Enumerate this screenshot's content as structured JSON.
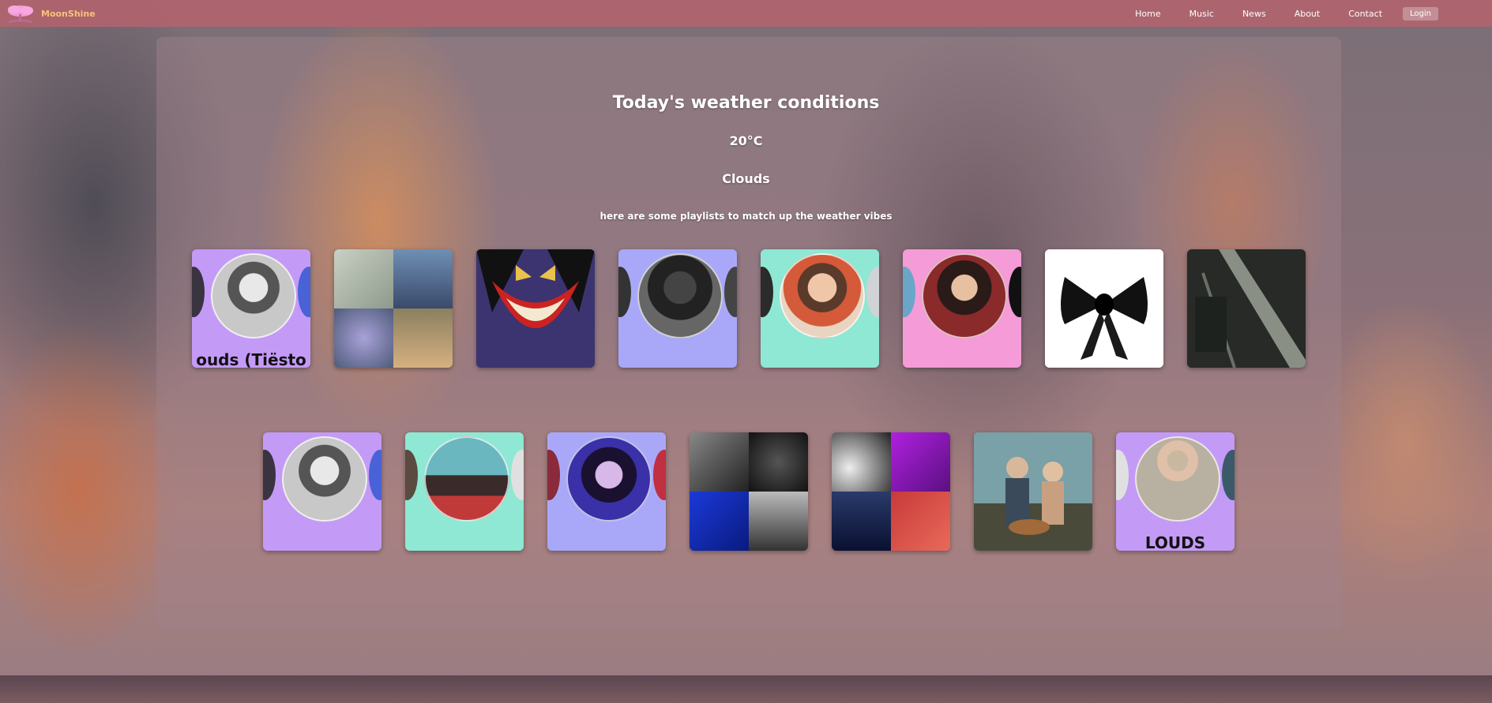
{
  "nav": {
    "brand": "MoonShine",
    "links": [
      "Home",
      "Music",
      "News",
      "About",
      "Contact"
    ],
    "login": "Login"
  },
  "weather": {
    "title": "Today's weather conditions",
    "temperature": "20°C",
    "condition": "Clouds",
    "subtitle": "here are some playlists to match up the weather vibes"
  },
  "playlists_row1": [
    {
      "kind": "artist",
      "bg": "#c49af7",
      "caption": "ouds (Tiësto"
    },
    {
      "kind": "collage"
    },
    {
      "kind": "art-joker"
    },
    {
      "kind": "artist",
      "bg": "#a9a8f8",
      "caption": ""
    },
    {
      "kind": "artist",
      "bg": "#8ee8d3",
      "caption": ""
    },
    {
      "kind": "artist",
      "bg": "#f49bd8",
      "caption": ""
    },
    {
      "kind": "art-bow"
    },
    {
      "kind": "art-rail"
    }
  ],
  "playlists_row2": [
    {
      "kind": "artist",
      "bg": "#c49af7",
      "caption": ""
    },
    {
      "kind": "artist",
      "bg": "#8ee8d3",
      "caption": ""
    },
    {
      "kind": "artist",
      "bg": "#a9a8f8",
      "caption": ""
    },
    {
      "kind": "collage-dark"
    },
    {
      "kind": "collage-purple"
    },
    {
      "kind": "movie"
    },
    {
      "kind": "artist",
      "bg": "#c49af7",
      "caption": "LOUDS"
    }
  ],
  "colors": {
    "navbar": "#b0646e",
    "brand": "#f7c27a",
    "lavender": "#c49af7",
    "periwinkle": "#a9a8f8",
    "mint": "#8ee8d3",
    "pink": "#f49bd8"
  }
}
